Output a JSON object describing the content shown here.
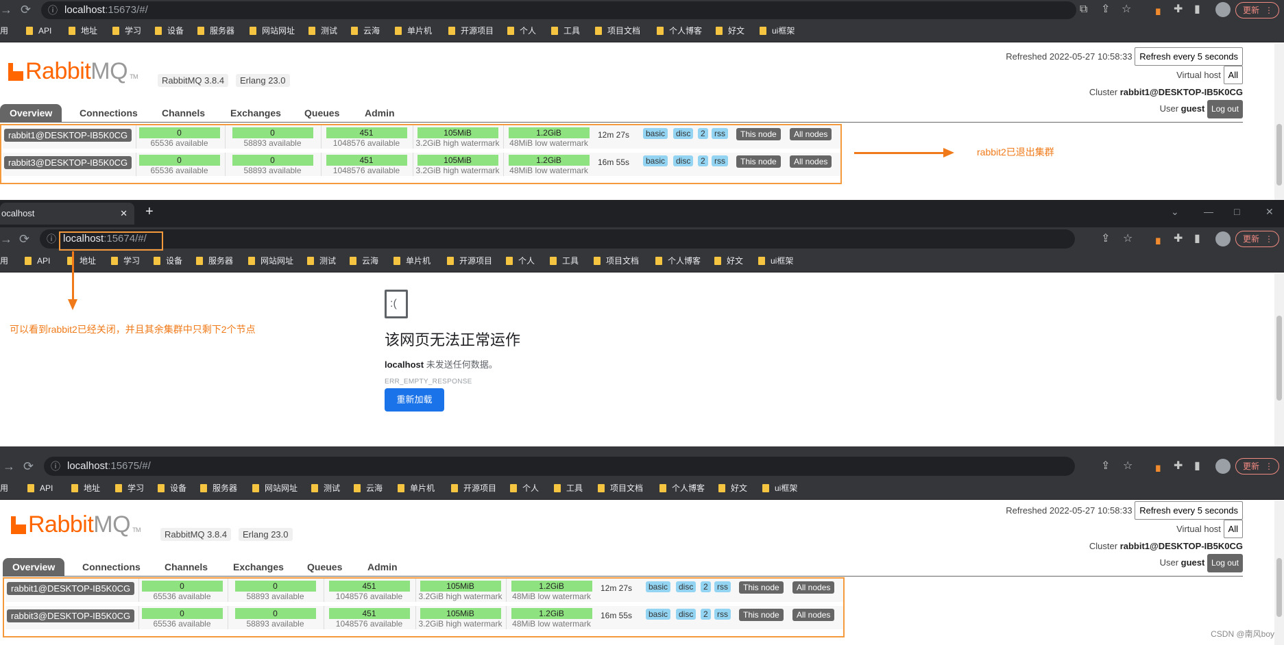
{
  "browser": {
    "refresh_icon": "reload-icon",
    "info_icon": "info-icon",
    "update_label": "更新",
    "menu_dots": "⋮",
    "bookmarks": [
      "用",
      "API",
      "地址",
      "学习",
      "设备",
      "服务器",
      "网站网址",
      "测试",
      "云海",
      "单片机",
      "开源项目",
      "个人",
      "工具",
      "项目文档",
      "个人博客",
      "好文",
      "ui框架"
    ],
    "colors": {
      "frame": "#35363a",
      "omnibox": "#202124",
      "bookmark_folder": "#f5c542",
      "update": "#f28b82"
    }
  },
  "window1": {
    "url_host": "localhost",
    "url_path": ":15673/#/"
  },
  "window2": {
    "tab_title": "ocalhost",
    "new_tab": "+",
    "url_host": "localhost",
    "url_path": ":15674/#/",
    "error_title": "该网页无法正常运作",
    "error_host": "localhost",
    "error_desc": " 未发送任何数据。",
    "error_code": "ERR_EMPTY_RESPONSE",
    "reload_label": "重新加载"
  },
  "window3": {
    "url_host": "localhost",
    "url_path": ":15675/#/"
  },
  "rabbit": {
    "logo_main": "Rabbit",
    "logo_mq": "MQ",
    "logo_tm": "TM",
    "version": "RabbitMQ 3.8.4",
    "erlang": "Erlang 23.0",
    "refreshed_label": "Refreshed 2022-05-27 10:58:33",
    "refresh_select": "Refresh every 5 seconds",
    "vhost_label": "Virtual host",
    "vhost_value": "All",
    "cluster_label": "Cluster",
    "cluster_value": "rabbit1@DESKTOP-IB5K0CG",
    "user_label": "User",
    "user_value": "guest",
    "logout_label": "Log out",
    "tabs": [
      "Overview",
      "Connections",
      "Channels",
      "Exchanges",
      "Queues",
      "Admin"
    ],
    "accent": "#ff6600",
    "nodes": [
      {
        "name": "rabbit1@DESKTOP-IB5K0CG",
        "fd": "0",
        "fd_sub": "65536 available",
        "sockets": "0",
        "sockets_sub": "58893 available",
        "procs": "451",
        "procs_sub": "1048576 available",
        "mem": "105MiB",
        "mem_sub": "3.2GiB high watermark",
        "disk": "1.2GiB",
        "disk_sub": "48MiB low watermark",
        "uptime": "12m 27s",
        "tags": [
          "basic",
          "disc",
          "2",
          "rss"
        ],
        "this_node": "This node",
        "all_nodes": "All nodes"
      },
      {
        "name": "rabbit3@DESKTOP-IB5K0CG",
        "fd": "0",
        "fd_sub": "65536 available",
        "sockets": "0",
        "sockets_sub": "58893 available",
        "procs": "451",
        "procs_sub": "1048576 available",
        "mem": "105MiB",
        "mem_sub": "3.2GiB high watermark",
        "disk": "1.2GiB",
        "disk_sub": "48MiB low watermark",
        "uptime": "16m 55s",
        "tags": [
          "basic",
          "disc",
          "2",
          "rss"
        ],
        "this_node": "This node",
        "all_nodes": "All nodes"
      }
    ]
  },
  "annotations": {
    "right_note": "rabbit2已退出集群",
    "left_note": "可以看到rabbit2已经关闭，并且其余集群中只剩下2个节点",
    "color": "#f07a19"
  },
  "watermark": "CSDN @南风boy"
}
